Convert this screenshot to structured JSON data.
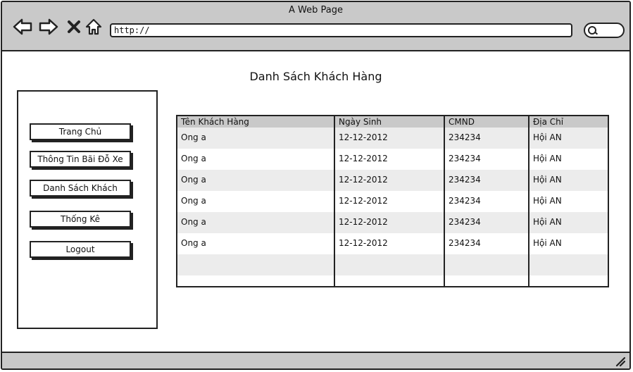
{
  "window": {
    "title": "A Web Page"
  },
  "browser": {
    "url": "http://",
    "icons": [
      "back-arrow-icon",
      "forward-arrow-icon",
      "close-x-icon",
      "home-icon",
      "search-icon",
      "resize-grip-icon"
    ]
  },
  "page": {
    "heading": "Danh Sách Khách Hàng"
  },
  "sidebar": {
    "items": [
      {
        "label": "Trang Chủ"
      },
      {
        "label": "Thông Tin Bãi Đỗ Xe"
      },
      {
        "label": "Danh Sách Khách"
      },
      {
        "label": "Thống Kê"
      },
      {
        "label": "Logout"
      }
    ]
  },
  "table": {
    "headers": [
      "Tên Khách Hàng",
      "Ngày Sinh",
      "CMND",
      "Địa Chỉ"
    ],
    "rows": [
      [
        "Ong a",
        "12-12-2012",
        "234234",
        "Hội AN"
      ],
      [
        "Ong a",
        "12-12-2012",
        "234234",
        "Hội AN"
      ],
      [
        "Ong a",
        "12-12-2012",
        "234234",
        "Hội AN"
      ],
      [
        "Ong a",
        "12-12-2012",
        "234234",
        "Hội AN"
      ],
      [
        "Ong a",
        "12-12-2012",
        "234234",
        "Hội AN"
      ],
      [
        "Ong a",
        "12-12-2012",
        "234234",
        "Hội AN"
      ],
      [
        "",
        "",
        "",
        ""
      ],
      [
        "",
        "",
        "",
        ""
      ]
    ]
  },
  "colors": {
    "chrome": "#c9c9c9",
    "stripe": "#ececec",
    "ink": "#222222"
  }
}
